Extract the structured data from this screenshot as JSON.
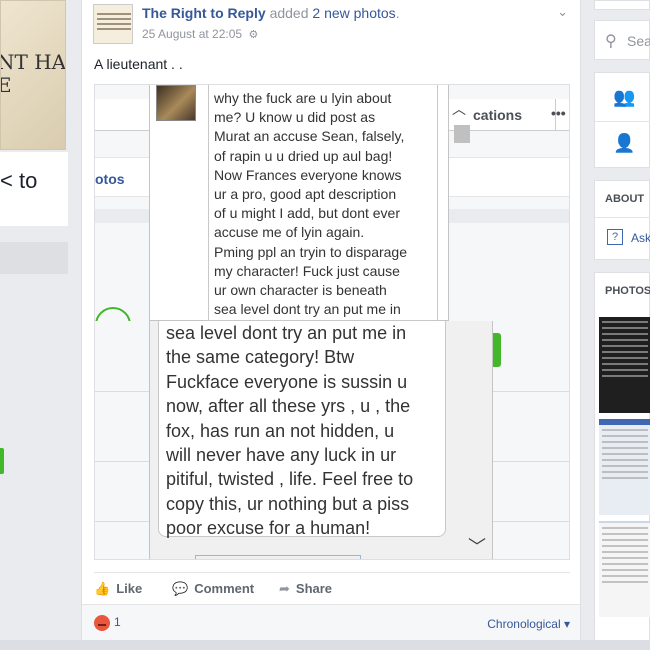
{
  "left": {
    "photo_text_1": "NT HAS",
    "photo_text_2": "E",
    "partial_text": "< to"
  },
  "post": {
    "page_name": "The Right to Reply",
    "action_text": "added",
    "photos_link": "2 new photos",
    "period": ".",
    "timestamp": "25 August at 22:05",
    "globe_icon": "⚙",
    "chevron": "⌄",
    "text": "A lieutenant . ."
  },
  "screenshot1": {
    "tab_label": "cations",
    "dots": "•••",
    "photos_tab": "otos",
    "message": "why the fuck are u lyin about\nme? U know u did post as\nMurat an accuse Sean, falsely,\nof rapin u u dried up aul bag!\nNow Frances everyone knows\nur a pro, good apt description\nof u might I add, but dont ever\naccuse me of lyin again.\nPming ppl an tryin to disparage\nmy character! Fuck just cause\nur own character is beneath\nsea level dont try an put me in"
  },
  "screenshot2": {
    "message": "sea level dont try an put me in\nthe same category! Btw\nFuckface everyone is sussin u\nnow, after all these yrs , u , the\nfox, has run an not hidden, u\nwill never have any luck in ur\npitiful, twisted , life. Feel free to\ncopy this, ur nothing but a piss\npoor excuse for a human!"
  },
  "actions": {
    "like_icon": "👍",
    "like": "Like",
    "comment_icon": "💬",
    "comment": "Comment",
    "share_icon": "➦",
    "share": "Share"
  },
  "footer": {
    "reaction_count": "1",
    "chronological": "Chronological ▾"
  },
  "sidebar": {
    "search_placeholder": "Sea",
    "about_label": "ABOUT",
    "ask_icon": "?",
    "ask_text": "Ask",
    "photos_label": "PHOTOS"
  },
  "colors": {
    "link": "#365899",
    "green": "#42b72a",
    "angry": "#e9573f"
  }
}
